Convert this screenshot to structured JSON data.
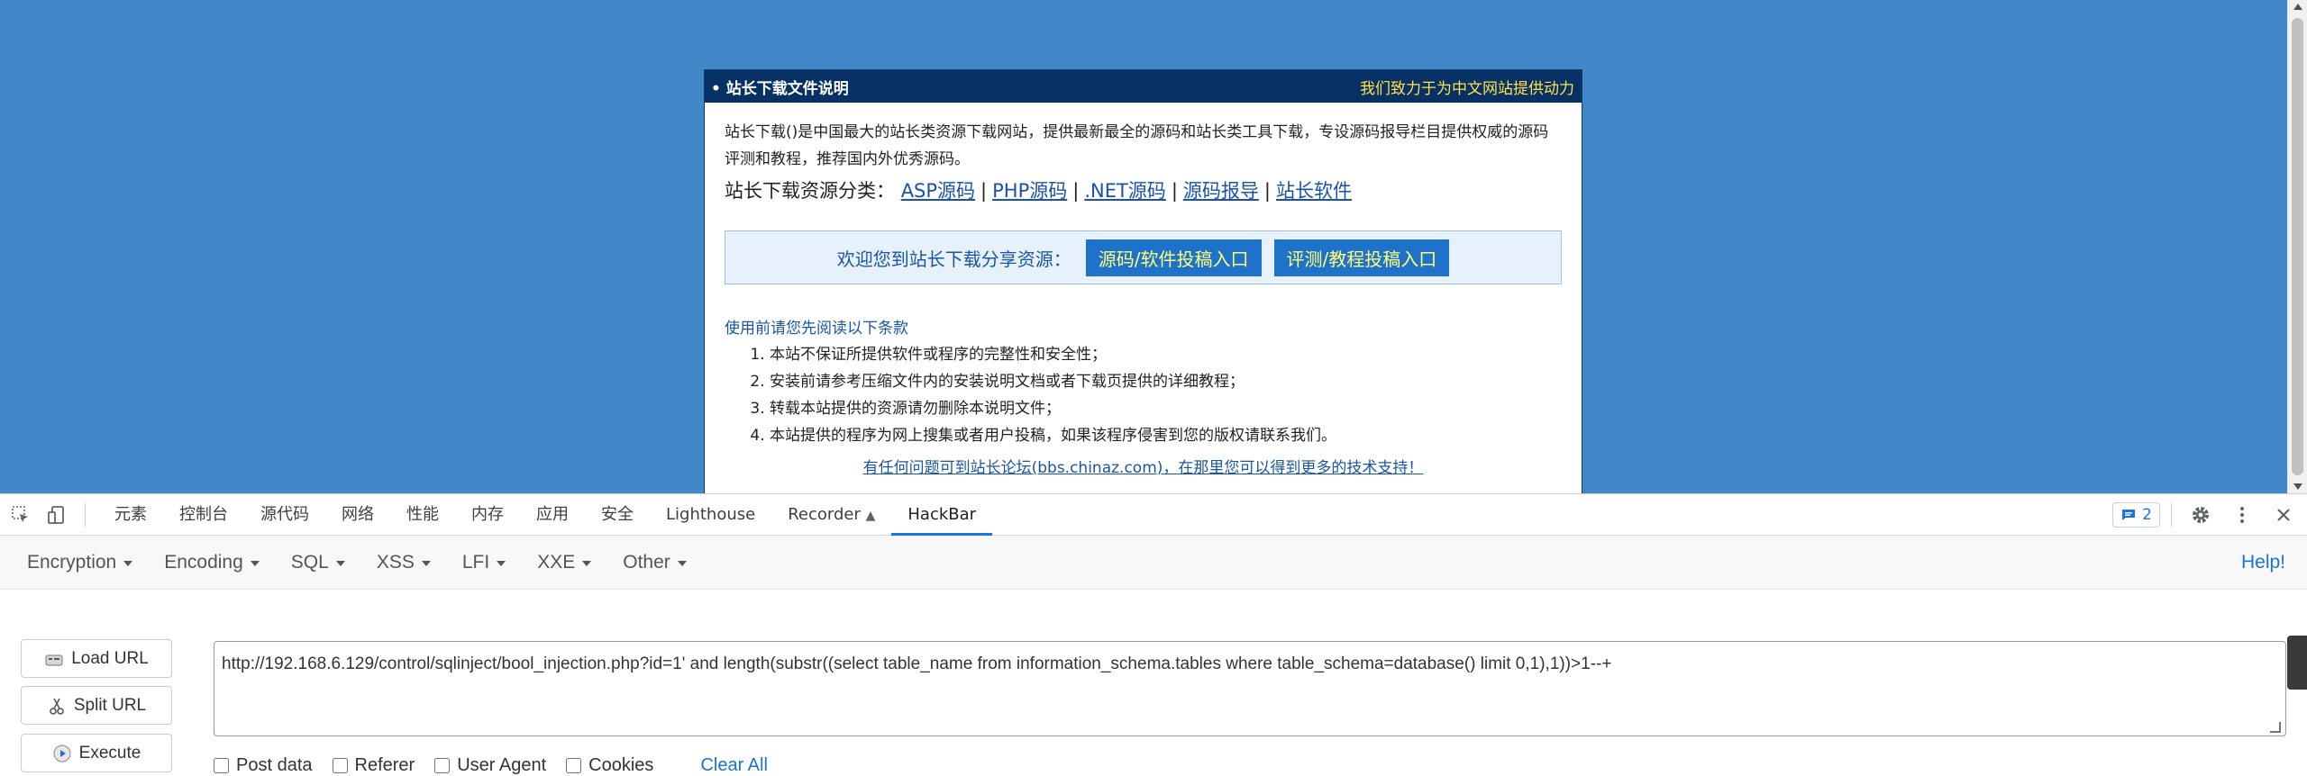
{
  "page": {
    "notice_title": "• 站长下载文件说明",
    "notice_slogan": "我们致力于为中文网站提供动力",
    "intro": "站长下载()是中国最大的站长类资源下载网站，提供最新最全的源码和站长类工具下载，专设源码报导栏目提供权威的源码评测和教程，推荐国内外优秀源码。",
    "categories_label": "站长下载资源分类：",
    "category_links": [
      "ASP源码",
      "PHP源码",
      ".NET源码",
      "源码报导",
      "站长软件"
    ],
    "category_separator": "|",
    "share_text": "欢迎您到站长下载分享资源：",
    "share_button_1": "源码/软件投稿入口",
    "share_button_2": "评测/教程投稿入口",
    "terms_title": "使用前请您先阅读以下条款",
    "terms": [
      "本站不保证所提供软件或程序的完整性和安全性；",
      "安装前请参考压缩文件内的安装说明文档或者下载页提供的详细教程；",
      "转载本站提供的资源请勿删除本说明文件；",
      "本站提供的程序为网上搜集或者用户投稿，如果该程序侵害到您的版权请联系我们。"
    ],
    "forum_link": "有任何问题可到站长论坛(bbs.chinaz.com)，在那里您可以得到更多的技术支持！"
  },
  "devtools": {
    "tabs": [
      "元素",
      "控制台",
      "源代码",
      "网络",
      "性能",
      "内存",
      "应用",
      "安全",
      "Lighthouse",
      "Recorder",
      "HackBar"
    ],
    "active_tab": "HackBar",
    "issues_count": "2"
  },
  "hackbar": {
    "menus": [
      "Encryption",
      "Encoding",
      "SQL",
      "XSS",
      "LFI",
      "XXE",
      "Other"
    ],
    "help": "Help!",
    "load_url": "Load URL",
    "split_url": "Split URL",
    "execute": "Execute",
    "url_value": "http://192.168.6.129/control/sqlinject/bool_injection.php?id=1' and length(substr((select table_name from information_schema.tables where table_schema=database() limit 0,1),1))>1--+",
    "options": [
      "Post data",
      "Referer",
      "User Agent",
      "Cookies"
    ],
    "clear_all": "Clear All"
  }
}
